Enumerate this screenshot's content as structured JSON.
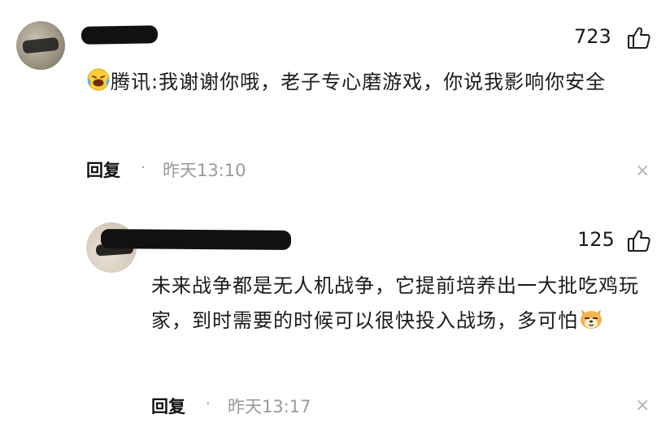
{
  "comments": [
    {
      "likes": "723",
      "emoji_icon": "laughing-crying-face-icon",
      "text": "腾讯:我谢谢你哦，老子专心磨游戏，你说我影响你安全",
      "reply_label": "回复",
      "separator": "·",
      "time": "昨天13:10",
      "close_icon": "×"
    },
    {
      "likes": "125",
      "text": "未来战争都是无人机战争，它提前培养出一大批吃鸡玩家，到时需要的时候可以很快投入战场，多可怕",
      "emoji_icon": "shiba-dog-face-icon",
      "reply_label": "回复",
      "separator": "·",
      "time": "昨天13:17",
      "close_icon": "×"
    }
  ]
}
